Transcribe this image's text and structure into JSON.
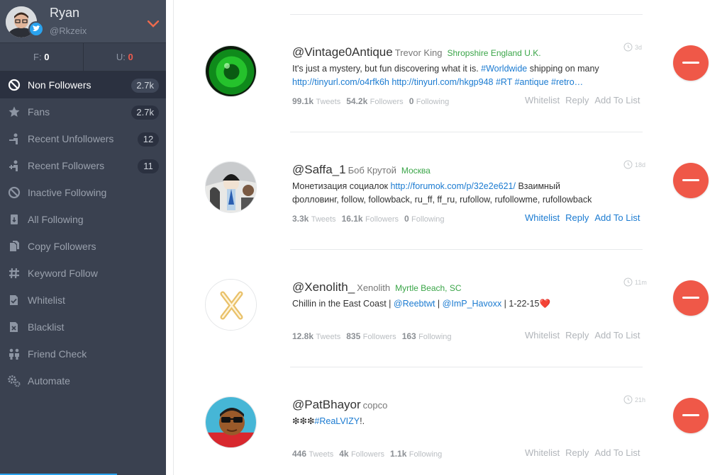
{
  "profile": {
    "name": "Ryan",
    "handle": "@Rkzeix"
  },
  "counts": {
    "f_label": "F:",
    "f_value": "0",
    "u_label": "U:",
    "u_value": "0"
  },
  "nav": [
    {
      "label": "Non Followers",
      "badge": "2.7k",
      "icon": "block-icon",
      "active": true
    },
    {
      "label": "Fans",
      "badge": "2.7k",
      "icon": "star-icon"
    },
    {
      "label": "Recent Unfollowers",
      "badge": "12",
      "icon": "user-minus-icon"
    },
    {
      "label": "Recent Followers",
      "badge": "11",
      "icon": "user-plus-icon"
    },
    {
      "label": "Inactive Following",
      "icon": "inactive-icon"
    },
    {
      "label": "All Following",
      "icon": "following-icon"
    },
    {
      "label": "Copy Followers",
      "icon": "copy-icon"
    },
    {
      "label": "Keyword Follow",
      "icon": "hashtag-icon"
    },
    {
      "label": "Whitelist",
      "icon": "whitelist-icon"
    },
    {
      "label": "Blacklist",
      "icon": "blacklist-icon"
    },
    {
      "label": "Friend Check",
      "icon": "friends-icon"
    },
    {
      "label": "Automate",
      "icon": "gears-icon"
    }
  ],
  "stat_labels": {
    "tweets": "Tweets",
    "followers": "Followers",
    "following": "Following"
  },
  "actions": {
    "whitelist": "Whitelist",
    "reply": "Reply",
    "add_to_list": "Add To List"
  },
  "cards": [
    {
      "handle": "@Vintage0Antique",
      "real_name": "Trevor King",
      "location": "Shropshire England U.K.",
      "bio_1": "It's just a mystery, but fun discovering what it is. ",
      "bio_tag": "#Worldwide",
      "bio_2": " shipping on many",
      "bio_line2": "http://tinyurl.com/o4rfk6h http://tinyurl.com/hkgp948 #RT #antique #retro…",
      "tweets": "99.1k",
      "followers": "54.2k",
      "following": "0",
      "time": "3d"
    },
    {
      "handle": "@Saffa_1",
      "real_name": "Боб Крутой",
      "location": "Москва",
      "bio_1": "Монетизация социалок ",
      "bio_link": "http://forumok.com/p/32e2e621/",
      "bio_2": " Взаимный",
      "bio_line2": "фолловинг, follow, followback, ru_ff, ff_ru, rufollow, rufollowme, rufollowback",
      "tweets": "3.3k",
      "followers": "16.1k",
      "following": "0",
      "time": "18d"
    },
    {
      "handle": "@Xenolith_",
      "real_name": "Xenolith",
      "location": "Myrtle Beach, SC",
      "bio_1": "Chillin in the East Coast | ",
      "bio_m1": "@Reebtwt",
      "bio_sep": " | ",
      "bio_m2": "@ImP_Havoxx",
      "bio_2": " | 1-22-15",
      "heart": "❤️",
      "tweets": "12.8k",
      "followers": "835",
      "following": "163",
      "time": "11m"
    },
    {
      "handle": "@PatBhayor",
      "real_name": "copco",
      "location": "",
      "bio_1": "❇❇❇",
      "bio_tag": "#ReaLVIZY",
      "bio_2": "!.",
      "tweets": "446",
      "followers": "4k",
      "following": "1.1k",
      "time": "21h"
    }
  ],
  "colors": {
    "accent_red": "#ef5848",
    "link_blue": "#1b7bd1",
    "location_green": "#3aa548",
    "sidebar_bg": "#3a4150"
  }
}
